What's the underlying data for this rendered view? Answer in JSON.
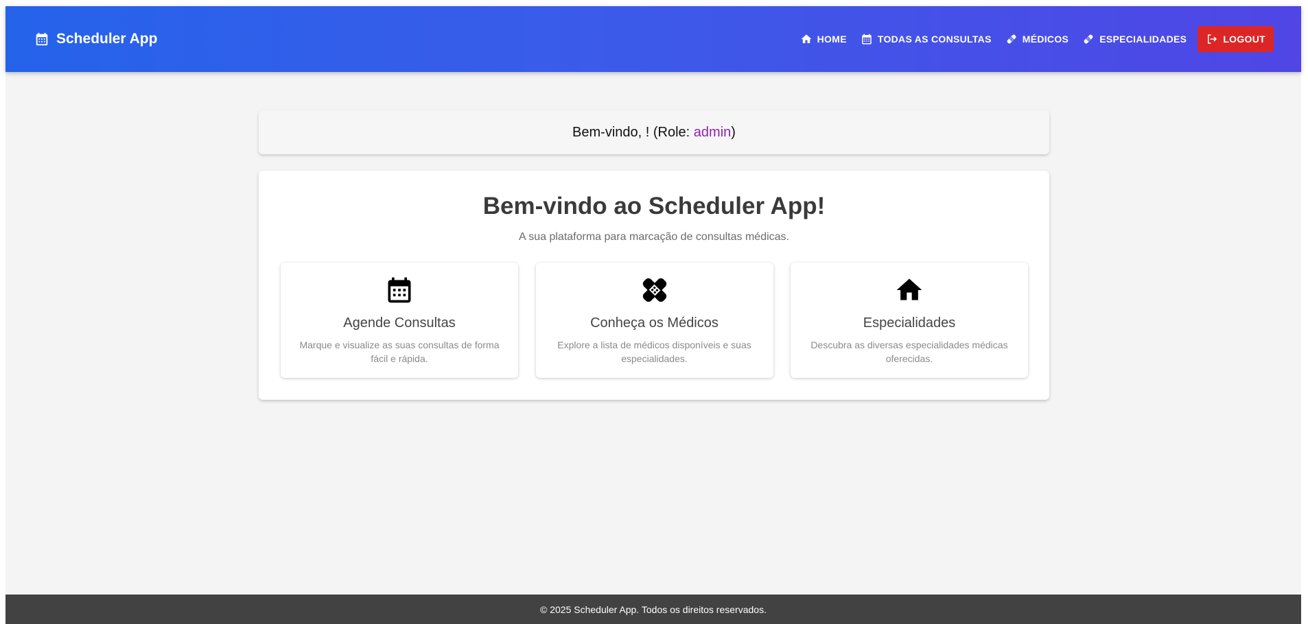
{
  "navbar": {
    "brand_icon": "calendar-icon",
    "brand": "Scheduler App",
    "items": [
      {
        "label": "HOME",
        "icon": "home-icon"
      },
      {
        "label": "TODAS AS CONSULTAS",
        "icon": "calendar-icon"
      },
      {
        "label": "MÉDICOS",
        "icon": "bandage-icon"
      },
      {
        "label": "ESPECIALIDADES",
        "icon": "bandage-icon"
      }
    ],
    "logout": {
      "label": "LOGOUT",
      "icon": "logout-icon",
      "color": "#dc2626"
    }
  },
  "welcome": {
    "prefix": "Bem-vindo, ! (Role: ",
    "role": "admin",
    "suffix": ")",
    "role_color": "#8e24aa"
  },
  "main": {
    "title": "Bem-vindo ao Scheduler App!",
    "subtitle": "A sua plataforma para marcação de consultas médicas.",
    "features": [
      {
        "icon": "calendar-icon",
        "title": "Agende Consultas",
        "description": "Marque e visualize as suas consultas de forma fácil e rápida."
      },
      {
        "icon": "bandage-icon",
        "title": "Conheça os Médicos",
        "description": "Explore a lista de médicos disponíveis e suas especialidades."
      },
      {
        "icon": "home-icon",
        "title": "Especialidades",
        "description": "Descubra as diversas especialidades médicas oferecidas."
      }
    ]
  },
  "footer": {
    "text": "© 2025 Scheduler App. Todos os direitos reservados."
  },
  "colors": {
    "nav_gradient_start": "#2563eb",
    "nav_gradient_end": "#4f46e5",
    "footer_bg": "#424242",
    "page_bg": "#f4f4f4"
  }
}
